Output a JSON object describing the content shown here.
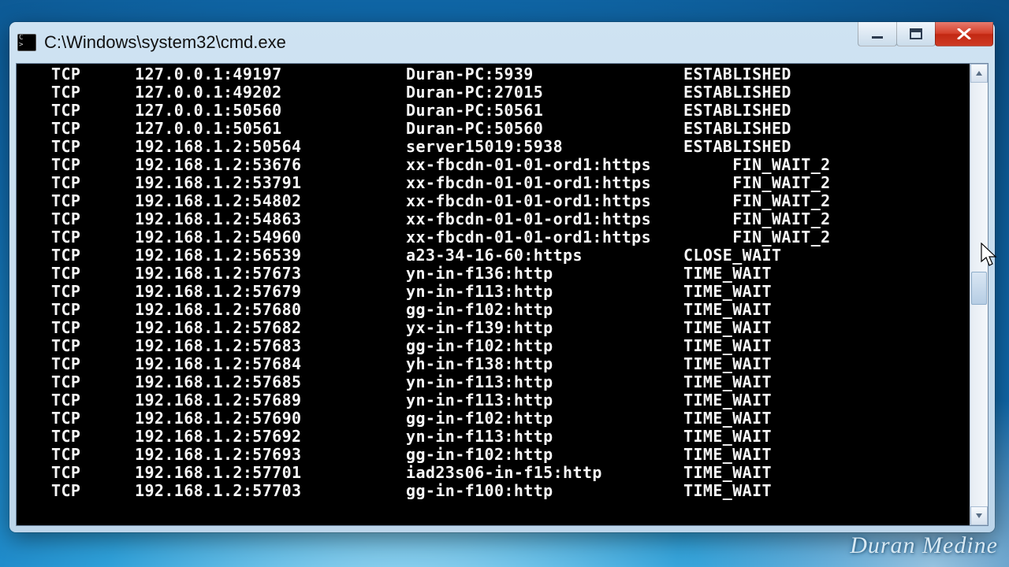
{
  "window": {
    "title": "C:\\Windows\\system32\\cmd.exe"
  },
  "watermark": "Duran Medine",
  "cols": {
    "indent": "  ",
    "proto_w": "TCP"
  },
  "rows": [
    {
      "proto": "TCP",
      "local": "127.0.0.1:49197",
      "foreign": "Duran-PC:5939",
      "state": "ESTABLISHED"
    },
    {
      "proto": "TCP",
      "local": "127.0.0.1:49202",
      "foreign": "Duran-PC:27015",
      "state": "ESTABLISHED"
    },
    {
      "proto": "TCP",
      "local": "127.0.0.1:50560",
      "foreign": "Duran-PC:50561",
      "state": "ESTABLISHED"
    },
    {
      "proto": "TCP",
      "local": "127.0.0.1:50561",
      "foreign": "Duran-PC:50560",
      "state": "ESTABLISHED"
    },
    {
      "proto": "TCP",
      "local": "192.168.1.2:50564",
      "foreign": "server15019:5938",
      "state": "ESTABLISHED"
    },
    {
      "proto": "TCP",
      "local": "192.168.1.2:53676",
      "foreign": "xx-fbcdn-01-01-ord1:https",
      "state": "FIN_WAIT_2"
    },
    {
      "proto": "TCP",
      "local": "192.168.1.2:53791",
      "foreign": "xx-fbcdn-01-01-ord1:https",
      "state": "FIN_WAIT_2"
    },
    {
      "proto": "TCP",
      "local": "192.168.1.2:54802",
      "foreign": "xx-fbcdn-01-01-ord1:https",
      "state": "FIN_WAIT_2"
    },
    {
      "proto": "TCP",
      "local": "192.168.1.2:54863",
      "foreign": "xx-fbcdn-01-01-ord1:https",
      "state": "FIN_WAIT_2"
    },
    {
      "proto": "TCP",
      "local": "192.168.1.2:54960",
      "foreign": "xx-fbcdn-01-01-ord1:https",
      "state": "FIN_WAIT_2"
    },
    {
      "proto": "TCP",
      "local": "192.168.1.2:56539",
      "foreign": "a23-34-16-60:https",
      "state": "CLOSE_WAIT"
    },
    {
      "proto": "TCP",
      "local": "192.168.1.2:57673",
      "foreign": "yn-in-f136:http",
      "state": "TIME_WAIT"
    },
    {
      "proto": "TCP",
      "local": "192.168.1.2:57679",
      "foreign": "yn-in-f113:http",
      "state": "TIME_WAIT"
    },
    {
      "proto": "TCP",
      "local": "192.168.1.2:57680",
      "foreign": "gg-in-f102:http",
      "state": "TIME_WAIT"
    },
    {
      "proto": "TCP",
      "local": "192.168.1.2:57682",
      "foreign": "yx-in-f139:http",
      "state": "TIME_WAIT"
    },
    {
      "proto": "TCP",
      "local": "192.168.1.2:57683",
      "foreign": "gg-in-f102:http",
      "state": "TIME_WAIT"
    },
    {
      "proto": "TCP",
      "local": "192.168.1.2:57684",
      "foreign": "yh-in-f138:http",
      "state": "TIME_WAIT"
    },
    {
      "proto": "TCP",
      "local": "192.168.1.2:57685",
      "foreign": "yn-in-f113:http",
      "state": "TIME_WAIT"
    },
    {
      "proto": "TCP",
      "local": "192.168.1.2:57689",
      "foreign": "yn-in-f113:http",
      "state": "TIME_WAIT"
    },
    {
      "proto": "TCP",
      "local": "192.168.1.2:57690",
      "foreign": "gg-in-f102:http",
      "state": "TIME_WAIT"
    },
    {
      "proto": "TCP",
      "local": "192.168.1.2:57692",
      "foreign": "yn-in-f113:http",
      "state": "TIME_WAIT"
    },
    {
      "proto": "TCP",
      "local": "192.168.1.2:57693",
      "foreign": "gg-in-f102:http",
      "state": "TIME_WAIT"
    },
    {
      "proto": "TCP",
      "local": "192.168.1.2:57701",
      "foreign": "iad23s06-in-f15:http",
      "state": "TIME_WAIT"
    },
    {
      "proto": "TCP",
      "local": "192.168.1.2:57703",
      "foreign": "gg-in-f100:http",
      "state": "TIME_WAIT"
    }
  ],
  "state_indent": {
    "ESTABLISHED": 0,
    "CLOSE_WAIT": 0,
    "TIME_WAIT": 0,
    "FIN_WAIT_2": 5
  }
}
